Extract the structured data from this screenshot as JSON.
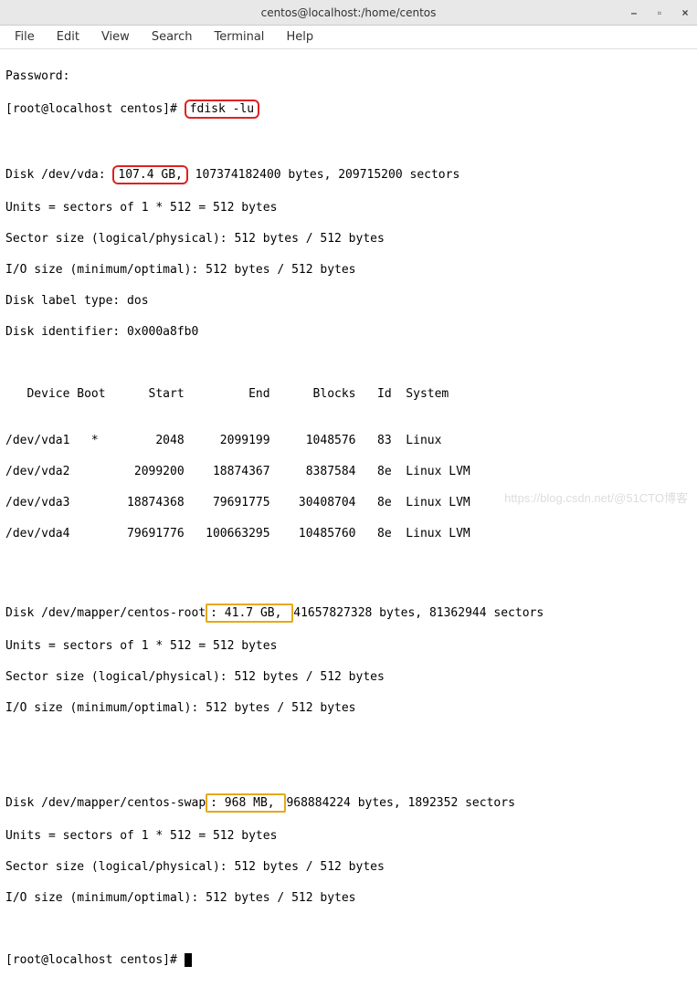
{
  "window": {
    "title": "centos@localhost:/home/centos",
    "controls": {
      "min": "–",
      "max": "▫",
      "close": "×"
    }
  },
  "menu": [
    "File",
    "Edit",
    "View",
    "Search",
    "Terminal",
    "Help"
  ],
  "term": {
    "password": "Password:",
    "prompt1_pre": "[root@localhost centos]# ",
    "cmd": "fdisk -lu",
    "disk_vda": {
      "pre": "Disk /dev/vda: ",
      "size": "107.4 GB,",
      "post": " 107374182400 bytes, 209715200 sectors"
    },
    "units": "Units = sectors of 1 * 512 = 512 bytes",
    "sector": "Sector size (logical/physical): 512 bytes / 512 bytes",
    "io": "I/O size (minimum/optimal): 512 bytes / 512 bytes",
    "label_type": "Disk label type: dos",
    "identifier": "Disk identifier: 0x000a8fb0",
    "part_header": "   Device Boot      Start         End      Blocks   Id  System",
    "partitions": [
      "/dev/vda1   *        2048     2099199     1048576   83  Linux",
      "/dev/vda2         2099200    18874367     8387584   8e  Linux LVM",
      "/dev/vda3        18874368    79691775    30408704   8e  Linux LVM",
      "/dev/vda4        79691776   100663295    10485760   8e  Linux LVM"
    ],
    "mapper_root": {
      "pre": "Disk /dev/mapper/centos-root",
      "size": ": 41.7 GB, ",
      "post": "41657827328 bytes, 81362944 sectors"
    },
    "units2": "Units = sectors of 1 * 512 = 512 bytes",
    "sector2": "Sector size (logical/physical): 512 bytes / 512 bytes",
    "io2": "I/O size (minimum/optimal): 512 bytes / 512 bytes",
    "mapper_swap": {
      "pre": "Disk /dev/mapper/centos-swap",
      "size": ": 968 MB, ",
      "post": "968884224 bytes, 1892352 sectors"
    },
    "units3": "Units = sectors of 1 * 512 = 512 bytes",
    "sector3": "Sector size (logical/physical): 512 bytes / 512 bytes",
    "io3": "I/O size (minimum/optimal): 512 bytes / 512 bytes",
    "prompt2": "[root@localhost centos]# "
  },
  "watermark": "https://blog.csdn.net/@51CTO博客"
}
